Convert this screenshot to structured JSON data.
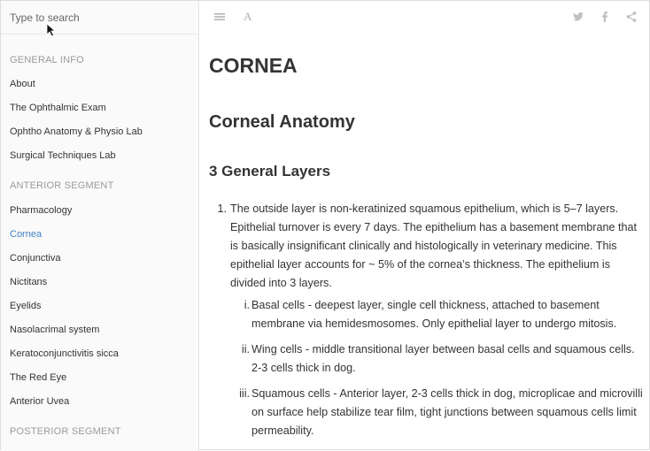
{
  "search": {
    "placeholder": "Type to search"
  },
  "sidebar": {
    "sections": [
      {
        "header": "GENERAL INFO",
        "items": [
          "About",
          "The Ophthalmic Exam",
          "Ophtho Anatomy & Physio Lab",
          "Surgical Techniques Lab"
        ]
      },
      {
        "header": "ANTERIOR SEGMENT",
        "items": [
          "Pharmacology",
          "Cornea",
          "Conjunctiva",
          "Nictitans",
          "Eyelids",
          "Nasolacrimal system",
          "Keratoconjunctivitis sicca",
          "The Red Eye",
          "Anterior Uvea"
        ]
      },
      {
        "header": "POSTERIOR SEGMENT",
        "items": []
      }
    ],
    "active_item": "Cornea"
  },
  "toolbar": {
    "left_icons": [
      "menu-icon",
      "font-icon"
    ],
    "font_label": "A",
    "right_icons": [
      "twitter-icon",
      "facebook-icon",
      "share-icon"
    ]
  },
  "main": {
    "title": "CORNEA",
    "section_title": "Corneal Anatomy",
    "subsection_title": "3 General Layers",
    "list": [
      {
        "marker": "1.",
        "text": "The outside layer is non-keratinized squamous epithelium, which is 5–7 layers. Epithelial turnover is every 7 days. The epithelium has a basement membrane that is basically insignificant clinically and histologically in veterinary medicine. This epithelial layer accounts for ~ 5% of the cornea’s thickness. The epithelium is divided into 3 layers.",
        "sublist": [
          {
            "marker": "i.",
            "text": "Basal cells - deepest layer, single cell thickness, attached to basement membrane via hemidesmosomes. Only epithelial layer to undergo mitosis."
          },
          {
            "marker": "ii.",
            "text": "Wing cells - middle transitional layer between basal cells and squamous cells. 2-3 cells thick in dog."
          },
          {
            "marker": "iii.",
            "text": "Squamous cells - Anterior layer, 2-3 cells thick in dog, microplicae and microvilli on surface help stabilize tear film, tight junctions between squamous cells limit permeability."
          }
        ]
      }
    ]
  },
  "colors": {
    "accent": "#4183c4",
    "text": "#333333",
    "muted": "#9a9a9a",
    "icon": "#b0b0b0"
  }
}
